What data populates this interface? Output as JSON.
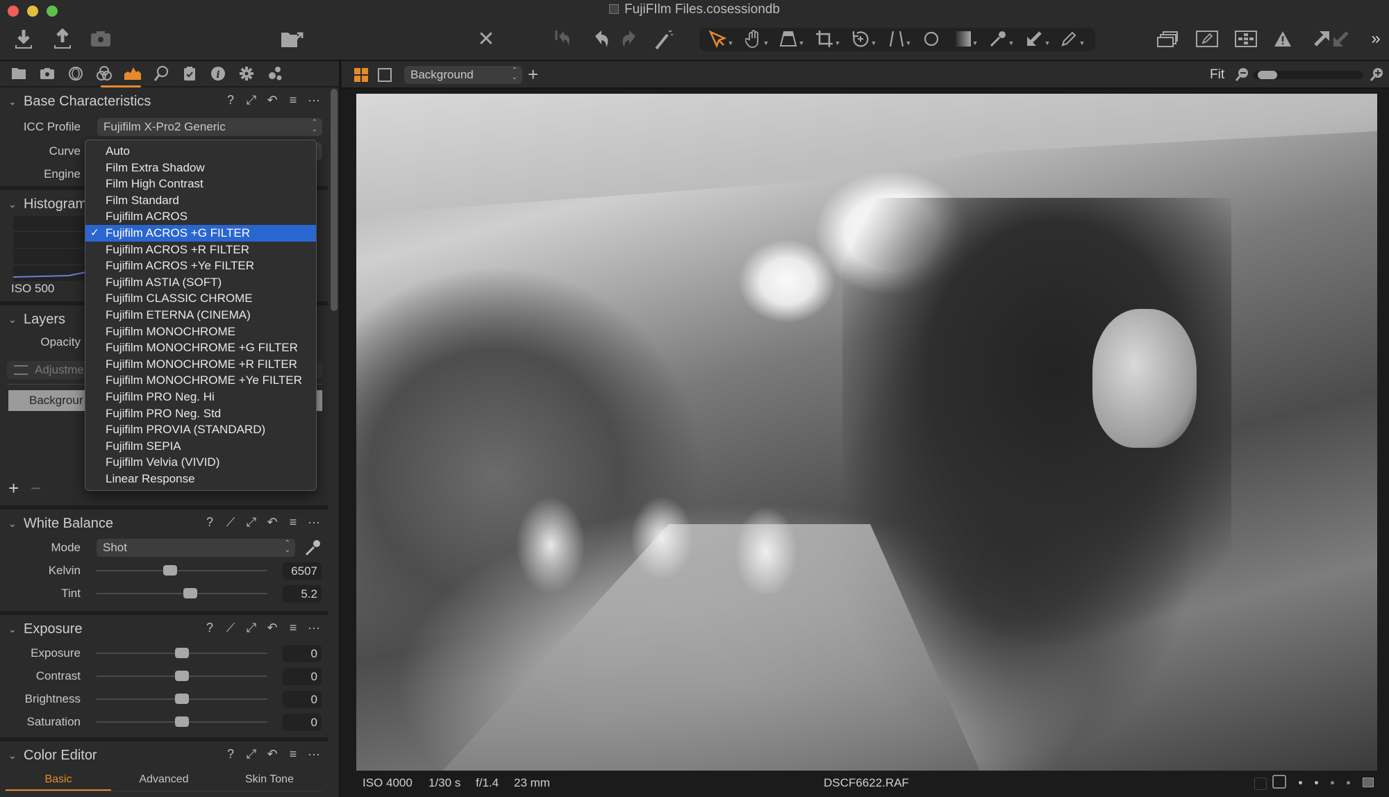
{
  "window": {
    "title": "FujiFIlm Files.cosessiondb"
  },
  "toolbar": {
    "left_icons": [
      "import-icon",
      "export-icon",
      "camera-icon",
      "tethered-folder-icon"
    ],
    "center_icons": [
      "delete-icon",
      "undo-all-icon",
      "undo-icon",
      "redo-icon",
      "auto-adjust-icon"
    ],
    "cursor_tools": [
      "select-cursor-icon",
      "pan-hand-icon",
      "keystone-icon",
      "crop-icon",
      "rotate-icon",
      "straighten-icon",
      "circle-mask-icon",
      "gradient-mask-icon",
      "color-picker-icon",
      "apply-adjustments-icon",
      "draw-mask-icon"
    ],
    "right_icons": [
      "variants-icon",
      "edit-mask-icon",
      "grid-icon",
      "exposure-warning-icon",
      "copy-adjustments-icon",
      "apply-adjustments-icon",
      "more-icon"
    ],
    "more_label": "»",
    "accent_color": "#e8892c"
  },
  "tool_tabs": [
    "library-icon",
    "capture-icon",
    "lens-icon",
    "color-icon",
    "exposure-icon",
    "details-icon",
    "adjustments-icon",
    "metadata-icon",
    "output-icon",
    "batch-icon"
  ],
  "base_characteristics": {
    "title": "Base Characteristics",
    "icc_label": "ICC Profile",
    "icc_value": "Fujifilm X-Pro2 Generic",
    "curve_label": "Curve",
    "engine_label": "Engine"
  },
  "curve_menu": {
    "selected_index": 5,
    "items": [
      "Auto",
      "Film Extra Shadow",
      "Film High Contrast",
      "Film Standard",
      "Fujifilm ACROS",
      "Fujifilm ACROS +G FILTER",
      "Fujifilm ACROS +R FILTER",
      "Fujifilm ACROS +Ye FILTER",
      "Fujifilm ASTIA (SOFT)",
      "Fujifilm CLASSIC CHROME",
      "Fujifilm ETERNA (CINEMA)",
      "Fujifilm MONOCHROME",
      "Fujifilm MONOCHROME +G FILTER",
      "Fujifilm MONOCHROME +R FILTER",
      "Fujifilm MONOCHROME +Ye FILTER",
      "Fujifilm PRO Neg. Hi",
      "Fujifilm PRO Neg. Std",
      "Fujifilm PROVIA (STANDARD)",
      "Fujifilm SEPIA",
      "Fujifilm Velvia (VIVID)",
      "Linear Response"
    ],
    "check": "✓"
  },
  "histogram": {
    "title": "Histogram",
    "iso_label": "ISO 500"
  },
  "layers": {
    "title": "Layers",
    "opacity_label": "Opacity",
    "adjustments_placeholder": "Adjustme",
    "background_layer": "Backgrour",
    "add_label": "+",
    "remove_label": "−"
  },
  "white_balance": {
    "title": "White Balance",
    "mode_label": "Mode",
    "mode_value": "Shot",
    "kelvin_label": "Kelvin",
    "kelvin_value": "6507",
    "kelvin_fraction": 0.43,
    "tint_label": "Tint",
    "tint_value": "5.2",
    "tint_fraction": 0.55
  },
  "exposure": {
    "title": "Exposure",
    "sliders": [
      {
        "label": "Exposure",
        "value": "0",
        "fraction": 0.5
      },
      {
        "label": "Contrast",
        "value": "0",
        "fraction": 0.5
      },
      {
        "label": "Brightness",
        "value": "0",
        "fraction": 0.5
      },
      {
        "label": "Saturation",
        "value": "0",
        "fraction": 0.5
      }
    ]
  },
  "color_editor": {
    "title": "Color Editor",
    "tabs": [
      {
        "label": "Basic",
        "active": true
      },
      {
        "label": "Advanced",
        "active": false
      },
      {
        "label": "Skin Tone",
        "active": false
      }
    ]
  },
  "viewer": {
    "layer_select": "Background",
    "zoom_label": "Fit",
    "zoom_fraction": 0.05
  },
  "status": {
    "iso": "ISO 4000",
    "shutter": "1/30 s",
    "aperture": "f/1.4",
    "focal": "23 mm",
    "filename": "DSCF6622.RAF"
  }
}
